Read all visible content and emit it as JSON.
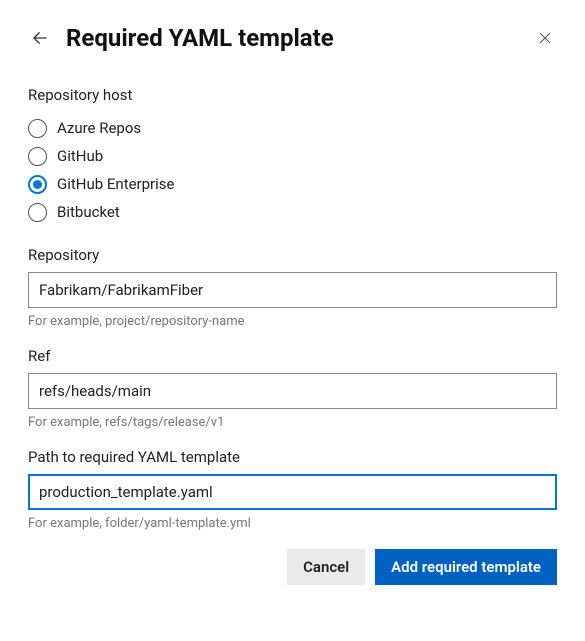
{
  "header": {
    "title": "Required YAML template"
  },
  "hostGroup": {
    "label": "Repository host",
    "options": [
      {
        "label": "Azure Repos",
        "selected": false
      },
      {
        "label": "GitHub",
        "selected": false
      },
      {
        "label": "GitHub Enterprise",
        "selected": true
      },
      {
        "label": "Bitbucket",
        "selected": false
      }
    ]
  },
  "repository": {
    "label": "Repository",
    "value": "Fabrikam/FabrikamFiber",
    "help": "For example, project/repository-name"
  },
  "ref": {
    "label": "Ref",
    "value": "refs/heads/main",
    "help": "For example, refs/tags/release/v1"
  },
  "path": {
    "label": "Path to required YAML template",
    "value": "production_template.yaml",
    "help": "For example, folder/yaml-template.yml"
  },
  "footer": {
    "cancel": "Cancel",
    "submit": "Add required template"
  }
}
